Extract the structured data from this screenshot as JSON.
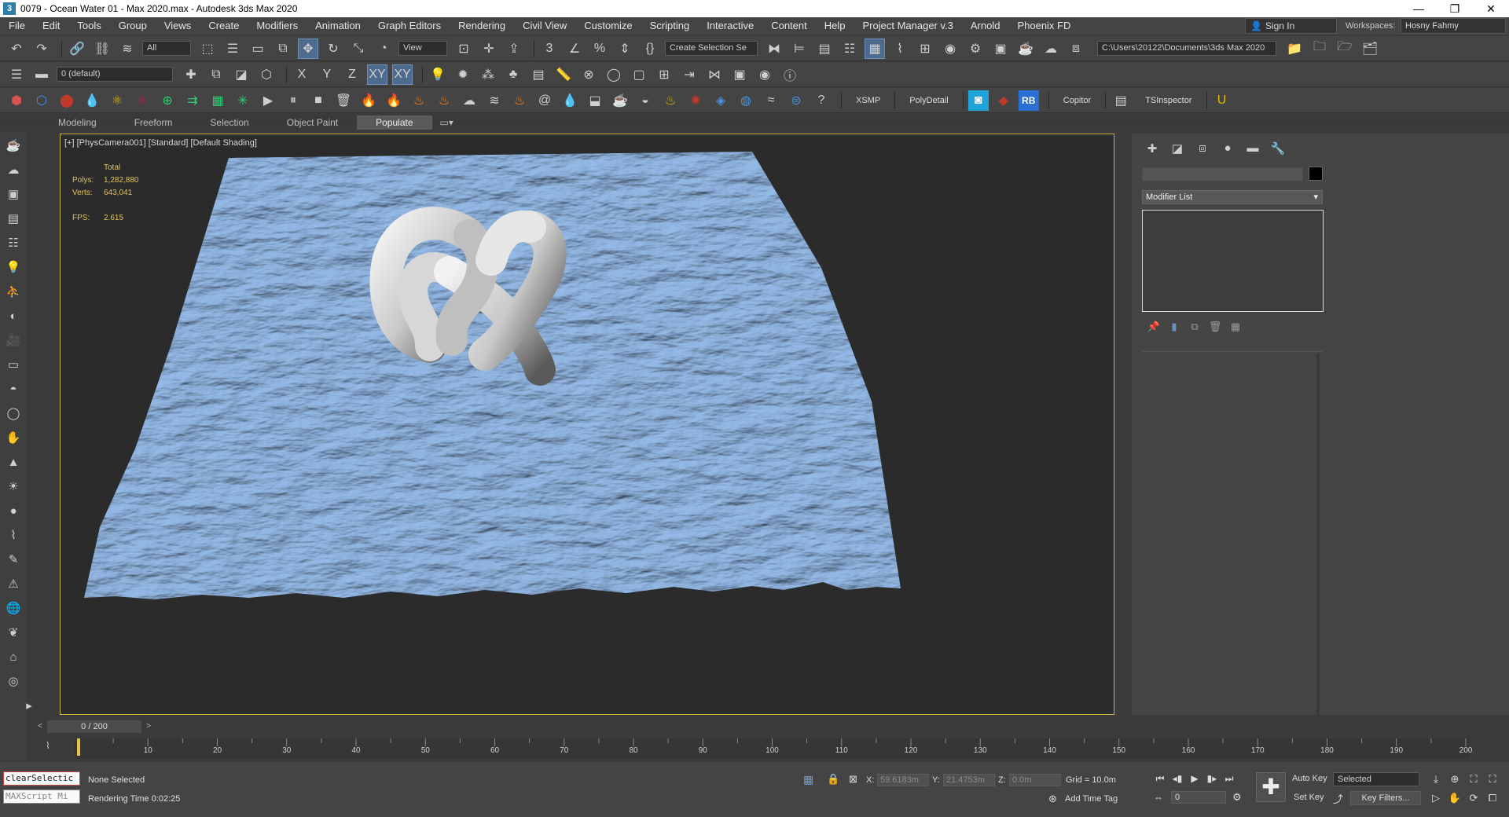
{
  "window": {
    "title": "0079 - Ocean Water 01 - Max 2020.max - Autodesk 3ds Max 2020",
    "app_icon": "3",
    "buttons": [
      "—",
      "❐",
      "✕"
    ]
  },
  "menu": [
    "File",
    "Edit",
    "Tools",
    "Group",
    "Views",
    "Create",
    "Modifiers",
    "Animation",
    "Graph Editors",
    "Rendering",
    "Civil View",
    "Customize",
    "Scripting",
    "Interactive",
    "Content",
    "Help",
    "Project Manager v.3",
    "Arnold",
    "Phoenix FD"
  ],
  "account": {
    "sign_in": "Sign In",
    "workspaces_label": "Workspaces:",
    "workspace": "Hosny Fahmy"
  },
  "toolbar1": {
    "selection_filter": "All",
    "ref_coord": "View",
    "named_selection": "Create Selection Se",
    "project_path": "C:\\Users\\20122\\Documents\\3ds Max 2020"
  },
  "toolbar2": {
    "layer": "0 (default)",
    "axes": [
      "X",
      "Y",
      "Z",
      "XY",
      "XY"
    ]
  },
  "toolbar3": {
    "labels": [
      "XSMP",
      "PolyDetail",
      "RB",
      "Copitor",
      "TSInspector"
    ]
  },
  "ribbon": {
    "tabs": [
      "Modeling",
      "Freeform",
      "Selection",
      "Object Paint",
      "Populate"
    ],
    "active": "Populate"
  },
  "viewport": {
    "label": "[+] [PhysCamera001] [Standard] [Default Shading]",
    "stats_header": "Total",
    "polys_label": "Polys:",
    "polys": "1,282,880",
    "verts_label": "Verts:",
    "verts": "643,041",
    "fps_label": "FPS:",
    "fps": "2.615",
    "water_color": "#8fb3de",
    "background": "#2b2b2b",
    "active_border": "#cfb43a"
  },
  "command_panel": {
    "modifier_list": "Modifier List"
  },
  "timeline": {
    "frame_display": "0 / 200",
    "ticks": [
      "10",
      "20",
      "30",
      "40",
      "50",
      "60",
      "70",
      "80",
      "90",
      "100",
      "110",
      "120",
      "130",
      "140",
      "150",
      "160",
      "170",
      "180",
      "190",
      "200"
    ]
  },
  "status": {
    "maxscript_line1": "clearSelectic",
    "maxscript_line2": "MAXScript Mi",
    "selection": "None Selected",
    "render_time": "Rendering Time  0:02:25",
    "x_label": "X:",
    "x": "59.6183m",
    "y_label": "Y:",
    "y": "21.4753m",
    "z_label": "Z:",
    "z": "0.0m",
    "grid": "Grid = 10.0m",
    "add_time_tag": "Add Time Tag",
    "current_frame": "0",
    "auto_key": "Auto Key",
    "set_key": "Set Key",
    "key_mode": "Selected",
    "key_filters": "Key Filters..."
  }
}
